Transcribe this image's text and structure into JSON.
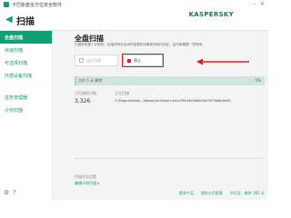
{
  "window": {
    "title": "卡巴斯基全方位安全软件",
    "minimize": "–",
    "close": "✕"
  },
  "header": {
    "back_icon": "back-arrow-icon",
    "title": "扫描",
    "brand": "KASPERSKY"
  },
  "sidebar": {
    "items": [
      {
        "label": "全盘扫描",
        "active": true
      },
      {
        "label": "快速扫描",
        "active": false
      },
      {
        "label": "可选择扫描",
        "active": false
      },
      {
        "label": "外部设备扫描",
        "active": false
      },
      {
        "label": "任务管理器",
        "active": false
      },
      {
        "label": "计划扫描",
        "active": false
      }
    ],
    "settings_icon": "gear-icon",
    "help_icon": "help-icon"
  },
  "main": {
    "title": "全盘扫描",
    "description": "扫描您的整个计算机。包括所有在启动时加载的对象和系统内存区，这可能需要一些时间。",
    "run_button": "运行扫描",
    "stop_button": "停止",
    "progress": {
      "text": "大约 5 天 剩余",
      "percent_label": "1%",
      "percent": 1
    },
    "scanned_label": "已扫描的对象",
    "scanned_value": "3,326",
    "current_label": "正在扫描",
    "current_value": "C:\\ProgramData\\...\\Bases\\Cache\\kjim.kdl.a765cf4e5b83e3b1f5f7f6dbc8d54",
    "schedule_label": "扫描任务设置",
    "schedule_link": "编辑计划扫描 ▸",
    "accent": "#119f75",
    "stop_outline": "#e02020"
  },
  "footer": {
    "links": [
      "更多产品",
      "我的卡巴斯基",
      "许可证：剩余 365 天"
    ]
  }
}
